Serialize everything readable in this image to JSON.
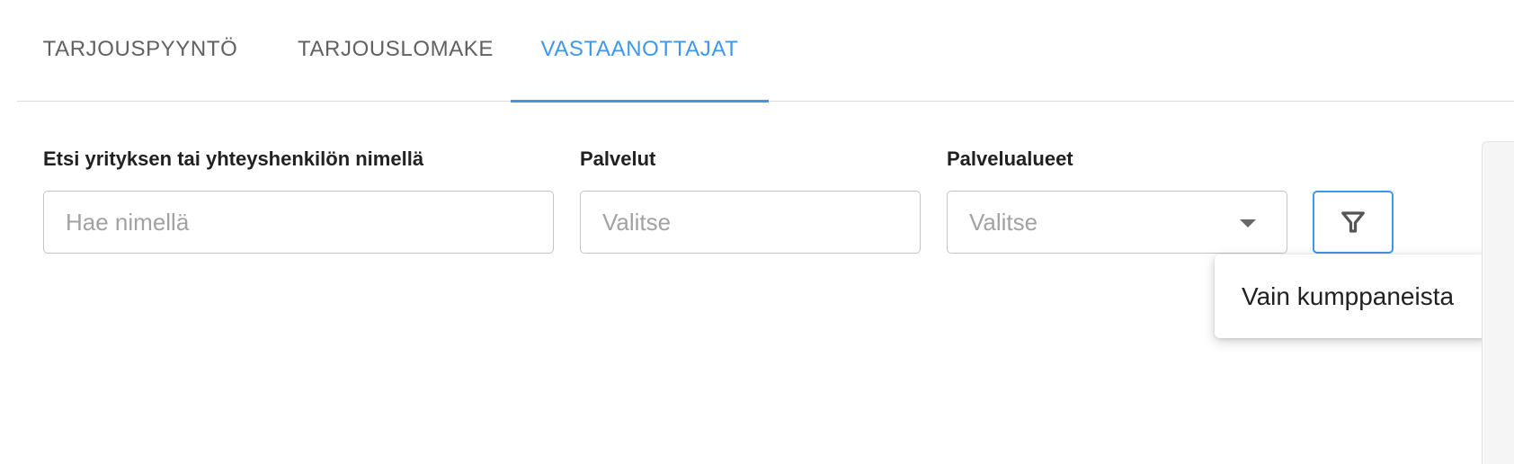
{
  "tabs": [
    {
      "label": "TARJOUSPYYNTÖ",
      "active": false
    },
    {
      "label": "TARJOUSLOMAKE",
      "active": false
    },
    {
      "label": "VASTAANOTTAJAT",
      "active": true
    }
  ],
  "filters": {
    "search": {
      "label": "Etsi yrityksen tai yhteyshenkilön nimellä",
      "placeholder": "Hae nimellä",
      "value": ""
    },
    "services": {
      "label": "Palvelut",
      "placeholder": "Valitse",
      "value": ""
    },
    "service_areas": {
      "label": "Palvelualueet",
      "placeholder": "Valitse",
      "value": ""
    },
    "filter_button_icon": "filter-icon"
  },
  "filter_menu": {
    "items": [
      {
        "label": "Vain kumppaneista"
      }
    ]
  },
  "colors": {
    "accent": "#3f97ea",
    "tab_inactive": "#616161",
    "border": "#c4c4c4",
    "placeholder": "#a2a2a2"
  }
}
